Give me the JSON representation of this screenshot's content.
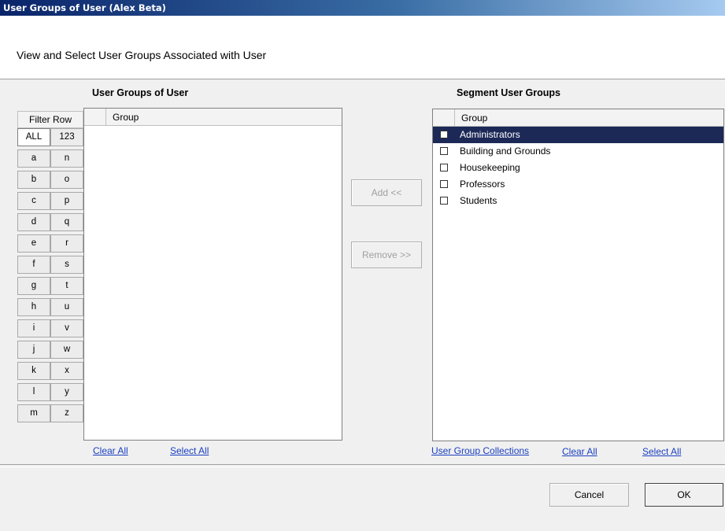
{
  "window": {
    "title": "User Groups of User (Alex Beta)"
  },
  "header": {
    "description": "View and Select User Groups Associated with User"
  },
  "left_panel": {
    "title": "User Groups of User",
    "filter_header": "Filter Row",
    "filters": [
      "ALL",
      "123",
      "a",
      "n",
      "b",
      "o",
      "c",
      "p",
      "d",
      "q",
      "e",
      "r",
      "f",
      "s",
      "g",
      "t",
      "h",
      "u",
      "i",
      "v",
      "j",
      "w",
      "k",
      "x",
      "l",
      "y",
      "m",
      "z"
    ],
    "column": "Group",
    "clear_all": "Clear All",
    "select_all": "Select All"
  },
  "middle": {
    "add_label": "Add <<",
    "remove_label": "Remove >>"
  },
  "right_panel": {
    "title": "Segment User Groups",
    "column": "Group",
    "rows": [
      {
        "label": "Administrators",
        "selected": true
      },
      {
        "label": "Building and Grounds",
        "selected": false
      },
      {
        "label": "Housekeeping",
        "selected": false
      },
      {
        "label": "Professors",
        "selected": false
      },
      {
        "label": "Students",
        "selected": false
      }
    ],
    "collections": "User Group Collections",
    "clear_all": "Clear All",
    "select_all": "Select All"
  },
  "footer": {
    "cancel": "Cancel",
    "ok": "OK"
  },
  "colors": {
    "selection": "#1c2957",
    "link": "#1a3fbf",
    "title_bar": "#0a246a"
  }
}
